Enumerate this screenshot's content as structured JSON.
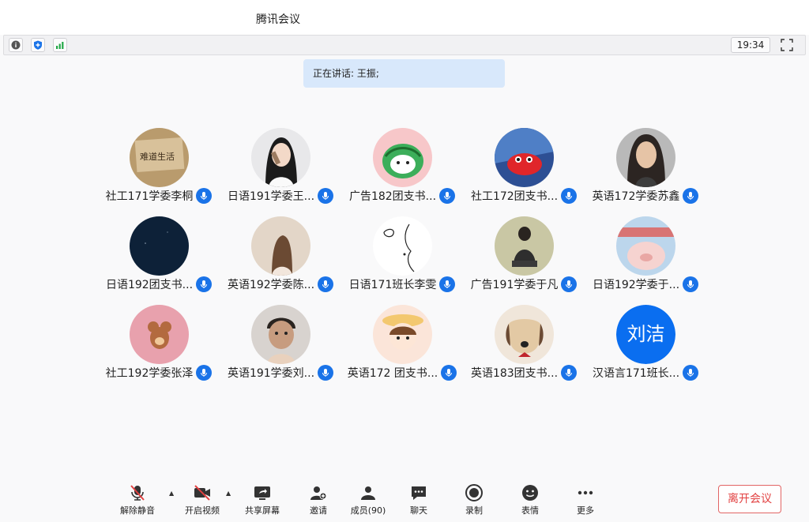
{
  "window": {
    "title": "腾讯会议"
  },
  "toolbar": {
    "clock": "19:34"
  },
  "speaker": {
    "label": "正在讲话: 王振;"
  },
  "participants": [
    {
      "name": "社工171学委李桐",
      "avatar": "photo-sign"
    },
    {
      "name": "日语191学委王...",
      "avatar": "photo-girl-drinking"
    },
    {
      "name": "广告182团支书...",
      "avatar": "cartoon-watermelon"
    },
    {
      "name": "社工172团支书...",
      "avatar": "cartoon-red-crab"
    },
    {
      "name": "英语172学委苏鑫",
      "avatar": "photo-woman"
    },
    {
      "name": "日语192团支书...",
      "avatar": "night-sky"
    },
    {
      "name": "英语192学委陈...",
      "avatar": "photo-girl-back"
    },
    {
      "name": "日语171班长李雯",
      "avatar": "line-drawing-face"
    },
    {
      "name": "广告191学委于凡",
      "avatar": "photo-person-sitting"
    },
    {
      "name": "日语192学委于...",
      "avatar": "photo-pig"
    },
    {
      "name": "社工192学委张泽",
      "avatar": "cartoon-jerry"
    },
    {
      "name": "英语191学委刘...",
      "avatar": "photo-baby"
    },
    {
      "name": "英语172 团支书...",
      "avatar": "cartoon-girl-hat"
    },
    {
      "name": "英语183团支书...",
      "avatar": "cartoon-dog"
    },
    {
      "name": "汉语言171班长...",
      "avatar": "text-avatar",
      "avatar_text": "刘洁"
    }
  ],
  "bottom": {
    "mute": "解除静音",
    "video": "开启视频",
    "share": "共享屏幕",
    "invite": "邀请",
    "members": "成员(90)",
    "chat": "聊天",
    "record": "录制",
    "emoji": "表情",
    "more": "更多",
    "leave": "离开会议"
  },
  "colors": {
    "accent": "#1a73e8",
    "leave": "#e24141",
    "banner": "#d8e8fb"
  }
}
